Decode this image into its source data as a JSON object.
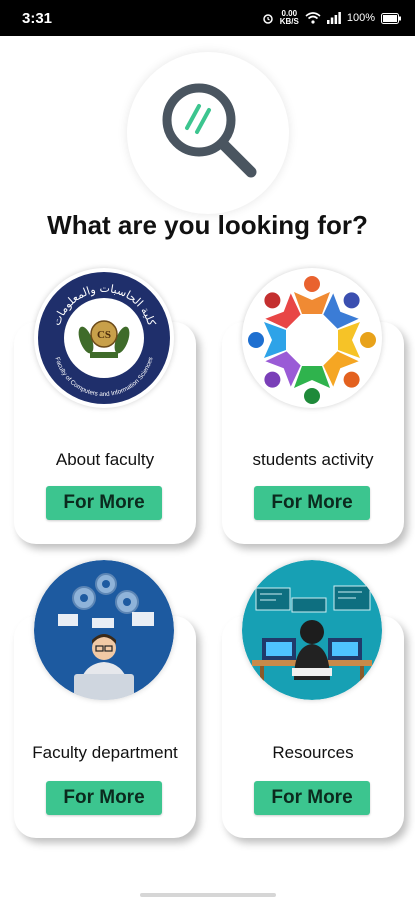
{
  "status": {
    "time": "3:31",
    "net_speed_top": "0.00",
    "net_speed_bottom": "KB/S",
    "battery": "100%"
  },
  "page": {
    "headline": "What are you looking for?"
  },
  "hero": {
    "icon": "magnifying-glass-icon"
  },
  "logo_text": {
    "arabic_arc": "كلية الحاسبات والمعلومات",
    "english_arc": "Faculty of Computers and Information Sciences",
    "badge": "CS"
  },
  "cards": [
    {
      "title": "About faculty",
      "button": "For More",
      "image": "faculty-logo"
    },
    {
      "title": "students activity",
      "button": "For More",
      "image": "people-circle-icon"
    },
    {
      "title": "Faculty department",
      "button": "For More",
      "image": "department-illustration"
    },
    {
      "title": "Resources",
      "button": "For More",
      "image": "resources-illustration"
    }
  ],
  "colors": {
    "accent": "#3cc58f",
    "magnifier": "#4a5560",
    "magnifier_lens": "#3cc58f"
  }
}
